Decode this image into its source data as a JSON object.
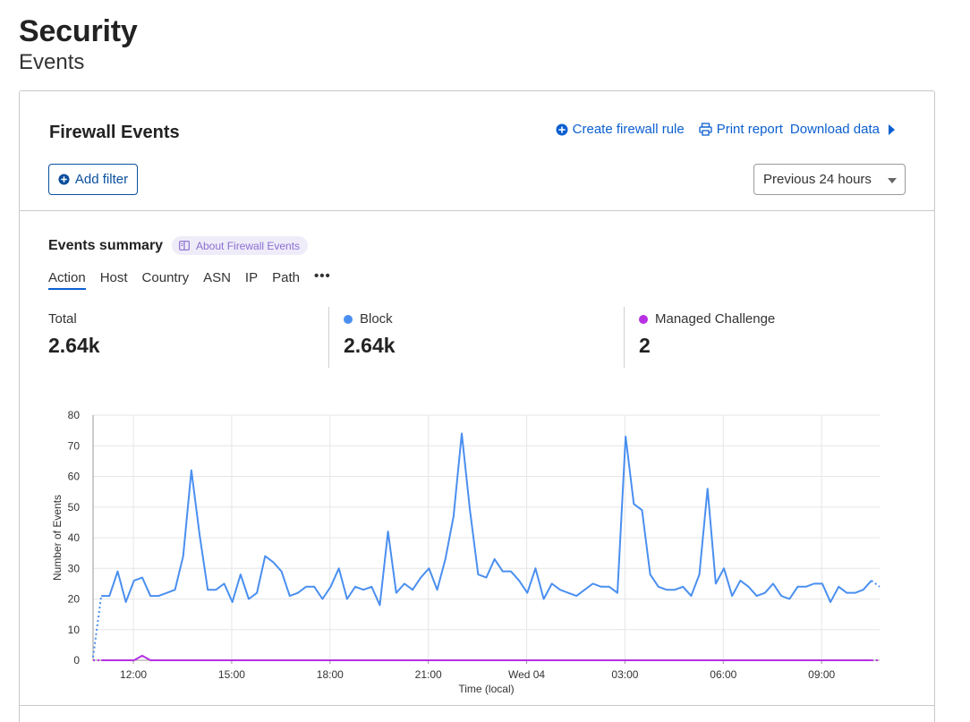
{
  "page": {
    "title": "Security",
    "subtitle": "Events"
  },
  "firewall": {
    "title": "Firewall Events",
    "actions": {
      "create_rule": "Create firewall rule",
      "print_report": "Print report",
      "download_data": "Download data"
    },
    "add_filter": "Add filter",
    "time_range": "Previous 24 hours"
  },
  "summary": {
    "title": "Events summary",
    "about_link": "About Firewall Events",
    "tabs": [
      "Action",
      "Host",
      "Country",
      "ASN",
      "IP",
      "Path"
    ],
    "active_tab": "Action",
    "more_icon": "more-horizontal-icon",
    "stats": [
      {
        "label": "Total",
        "value": "2.64k"
      },
      {
        "label": "Block",
        "value": "2.64k",
        "color": "#4a8ff0"
      },
      {
        "label": "Managed Challenge",
        "value": "2",
        "color": "#b730e3"
      }
    ]
  },
  "colors": {
    "accent": "#0b5fd1",
    "block": "#4a8ff0",
    "challenge": "#b730e3"
  },
  "chart_data": {
    "type": "line",
    "xlabel": "Time (local)",
    "ylabel": "Number of Events",
    "ylim": [
      0,
      80
    ],
    "yticks": [
      0,
      10,
      20,
      30,
      40,
      50,
      60,
      70,
      80
    ],
    "x_start_hour": 10.77,
    "x_end_hour": 34.77,
    "xticks": [
      {
        "hour": 12,
        "label": "12:00"
      },
      {
        "hour": 15,
        "label": "15:00"
      },
      {
        "hour": 18,
        "label": "18:00"
      },
      {
        "hour": 21,
        "label": "21:00"
      },
      {
        "hour": 24,
        "label": "Wed 04"
      },
      {
        "hour": 27,
        "label": "03:00"
      },
      {
        "hour": 30,
        "label": "06:00"
      },
      {
        "hour": 33,
        "label": "09:00"
      }
    ],
    "grid": true,
    "series": [
      {
        "name": "Block",
        "color": "#4a8ff0",
        "values": [
          1,
          21,
          21,
          29,
          19,
          26,
          27,
          21,
          21,
          22,
          23,
          34,
          62,
          41,
          23,
          23,
          25,
          19,
          28,
          20,
          22,
          34,
          32,
          29,
          21,
          22,
          24,
          24,
          20,
          24,
          30,
          20,
          24,
          23,
          24,
          18,
          42,
          22,
          25,
          23,
          27,
          30,
          23,
          33,
          47,
          74,
          49,
          28,
          27,
          33,
          29,
          29,
          26,
          22,
          30,
          20,
          25,
          23,
          22,
          21,
          23,
          25,
          24,
          24,
          22,
          73,
          51,
          49,
          28,
          24,
          23,
          23,
          24,
          21,
          28,
          56,
          25,
          30,
          21,
          26,
          24,
          21,
          22,
          25,
          21,
          20,
          24,
          24,
          25,
          25,
          19,
          24,
          22,
          22,
          23,
          26,
          24
        ]
      },
      {
        "name": "Managed Challenge",
        "color": "#b730e3",
        "values": [
          0,
          0,
          0,
          0,
          0,
          0,
          1.5,
          0,
          0,
          0,
          0,
          0,
          0,
          0,
          0,
          0,
          0,
          0,
          0,
          0,
          0,
          0,
          0,
          0,
          0,
          0,
          0,
          0,
          0,
          0,
          0,
          0,
          0,
          0,
          0,
          0,
          0,
          0,
          0,
          0,
          0,
          0,
          0,
          0,
          0,
          0,
          0,
          0,
          0,
          0,
          0,
          0,
          0,
          0,
          0,
          0,
          0,
          0,
          0,
          0,
          0,
          0,
          0,
          0,
          0,
          0,
          0,
          0,
          0,
          0,
          0,
          0,
          0,
          0,
          0,
          0,
          0,
          0,
          0,
          0,
          0,
          0,
          0,
          0,
          0,
          0,
          0,
          0,
          0,
          0,
          0,
          0,
          0,
          0,
          0,
          0,
          0
        ]
      }
    ]
  }
}
